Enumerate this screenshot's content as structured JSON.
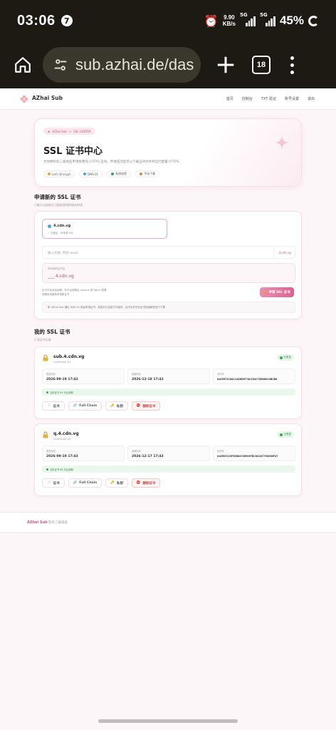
{
  "status_bar": {
    "time": "03:06",
    "notif_badge": "7",
    "speed_value": "9.90",
    "speed_unit": "KB/s",
    "network_1": "5G",
    "network_2": "5G",
    "battery": "45%"
  },
  "browser": {
    "url": "sub.azhai.de/das",
    "tab_count": "18"
  },
  "nav": {
    "brand": "AZhai Sub",
    "links": [
      "首页",
      "控制台",
      "TXT 验证",
      "账号设置",
      "退出"
    ]
  },
  "hero": {
    "breadcrumb_root": "AZhai Sub",
    "breadcrumb_sep": ">",
    "breadcrumb_current": "SSL CENTER",
    "title": "SSL 证书中心",
    "description": "为你拥有的二级域名申请免费的 HTTPS 证书。申请成功后可以下载证书文件并自行配置 HTTPS",
    "chips": [
      {
        "label": "Let's Encrypt",
        "color": "#e8a640"
      },
      {
        "label": "DNS-01",
        "color": "#4ea2e8"
      },
      {
        "label": "私钥加密",
        "color": "#3aa65b"
      },
      {
        "label": "手动下载",
        "color": "#c98a4a"
      }
    ]
  },
  "apply": {
    "title": "申请新的 SSL 证书",
    "subtitle": "只能为当前账号已提前获得的域名申请",
    "domain_option": {
      "name": "4.cdn.vg",
      "status": "✓ 已验证 · 可申请 SSL"
    },
    "sub_placeholder": "输入前缀, 例如 www",
    "suffix": ".4.cdn.vg",
    "cert_name_label": "将申请的证书名",
    "cert_name_value": "___.4.cdn.vg",
    "note_line1": "证书不会自动续期，在平台续期后 Apache 或 Nginx 配置",
    "note_line2": "到期前请重新申请新证书",
    "apply_button": "申请 SSL 证书",
    "tip": "AZhai Sub 通过 DNS-01 验证申请证书，私钥只以加密方式保存，证书文件仅在证书页面被您自行下载"
  },
  "my_certs": {
    "title": "我的 SSL 证书",
    "subtitle": "2 张证书记录",
    "labels": {
      "issued": "签发时间",
      "expires": "到期时间",
      "serial": "序列号"
    },
    "actions": [
      "证书",
      "Full Chain",
      "私钥",
      "删除证书"
    ],
    "items": [
      {
        "domain": "sub.4.cdn.vg",
        "cert_id": "Certificate #7",
        "status": "已签发",
        "issued": "2026-09-19 17:42",
        "expires": "2026-12-18 17:42",
        "serial": "0x05673C8AC12D6E5F7ACC54C756D6819BCB6",
        "renew_note": "当前证书 89 天后到期"
      },
      {
        "domain": "q.4.cdn.vg",
        "cert_id": "Certificate #6",
        "status": "已签发",
        "issued": "2026-09-19 17:43",
        "expires": "2026-12-17 17:43",
        "serial": "0x0EEC316F55B82C56996TBCD41EC796C66F47",
        "renew_note": "当前证书 88 天后到期"
      }
    ]
  },
  "footer": {
    "brand": "AZhai Sub",
    "description": "轻享二级域名"
  }
}
